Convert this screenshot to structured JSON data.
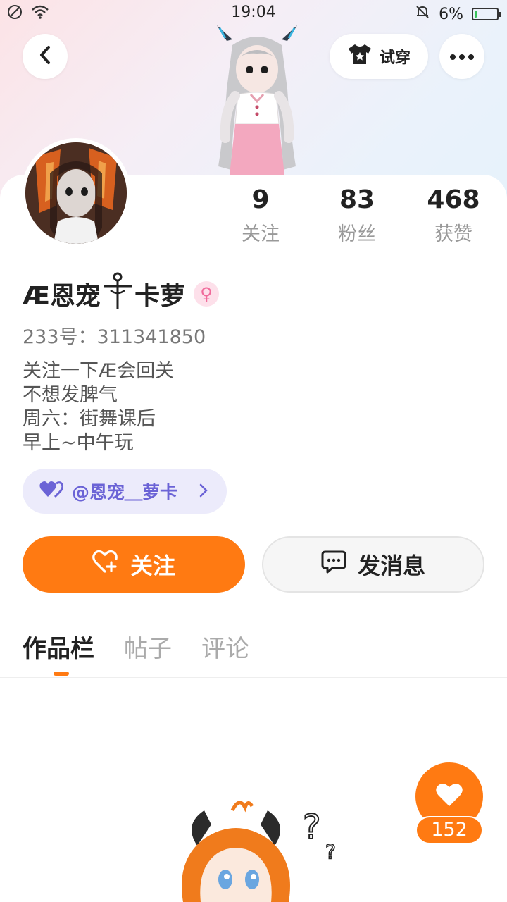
{
  "status_bar": {
    "time": "19:04",
    "battery_percent": "6%",
    "battery_level": 0.06
  },
  "header": {
    "tryon_label": "试穿"
  },
  "profile": {
    "stats": [
      {
        "value": "9",
        "label": "关注"
      },
      {
        "value": "83",
        "label": "粉丝"
      },
      {
        "value": "468",
        "label": "获赞"
      }
    ],
    "username": "Æ恩宠",
    "username_suffix": "卡萝",
    "gender_symbol": "♀",
    "uid": "233号：311341850",
    "bio": [
      "关注一下Æ会回关",
      "不想发脾气",
      "周六：街舞课后",
      "早上~中午玩"
    ],
    "fan_badge": "@恩宠＿萝卡",
    "follow_label": "关注",
    "message_label": "发消息"
  },
  "tabs": [
    {
      "label": "作品栏",
      "active": true
    },
    {
      "label": "帖子",
      "active": false
    },
    {
      "label": "评论",
      "active": false
    }
  ],
  "like": {
    "count": "152"
  },
  "colors": {
    "accent": "#ff7a12",
    "badge_bg": "#ecebfb",
    "badge_text": "#6b63d6",
    "gender_pink": "#f06a9a"
  }
}
